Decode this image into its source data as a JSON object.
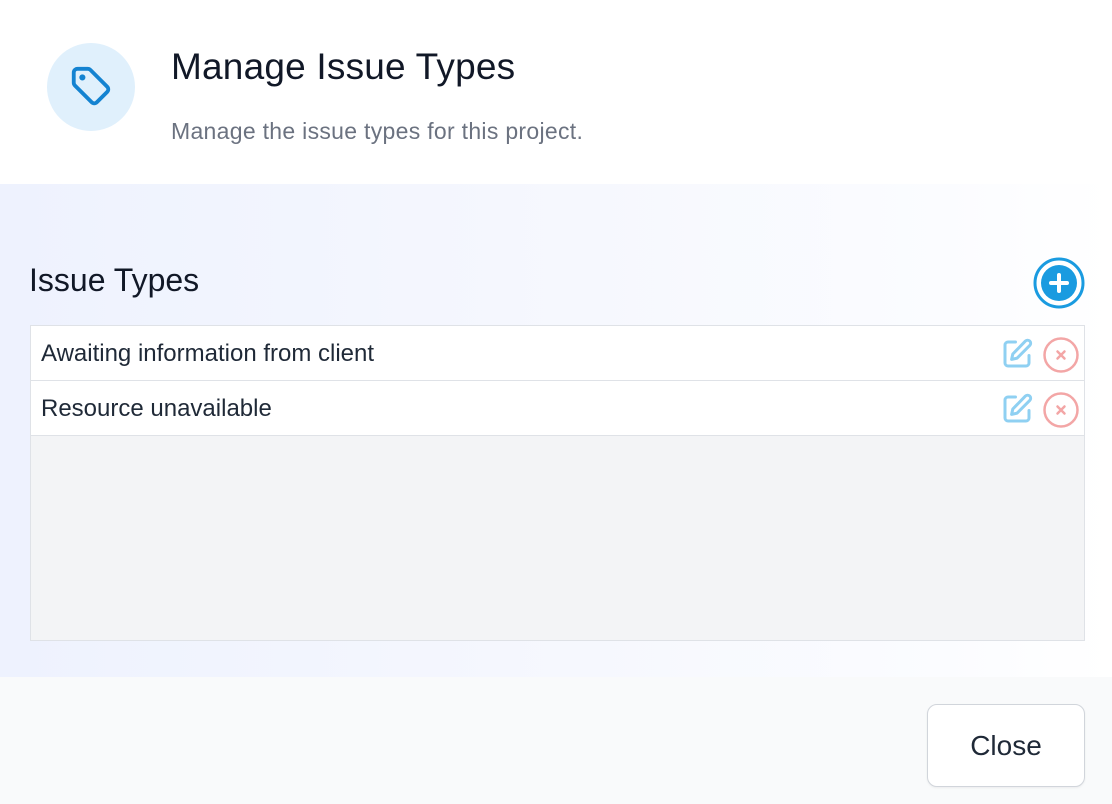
{
  "header": {
    "icon": "tag-icon",
    "title": "Manage Issue Types",
    "subtitle": "Manage the issue types for this project."
  },
  "section": {
    "title": "Issue Types",
    "add_icon": "plus-circle-icon"
  },
  "issue_types": [
    {
      "label": "Awaiting information from client"
    },
    {
      "label": "Resource unavailable"
    }
  ],
  "row_actions": {
    "edit_icon": "pencil-square-icon",
    "delete_icon": "x-circle-icon"
  },
  "footer": {
    "close_label": "Close"
  },
  "colors": {
    "accent_blue": "#1a9be0",
    "edit_blue": "#8fd0f2",
    "delete_red": "#f3a6a6",
    "icon_bg": "#e0f0fc"
  }
}
